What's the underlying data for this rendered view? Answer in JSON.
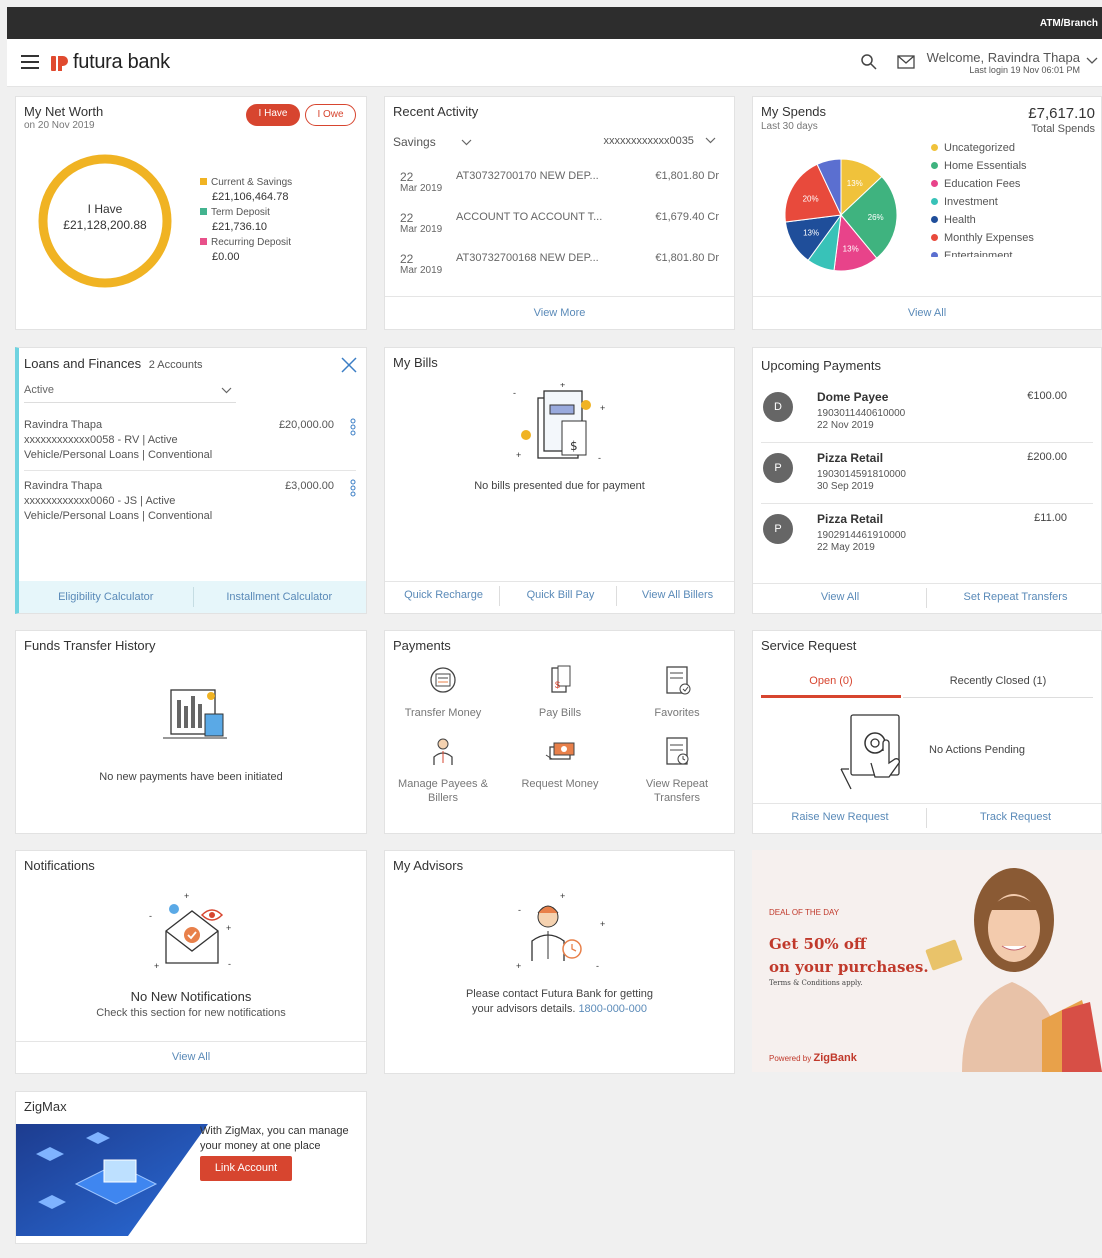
{
  "topbar": {
    "atm_label": "ATM/Branch"
  },
  "header": {
    "logo_text": "futura bank",
    "welcome": "Welcome, Ravindra Thapa",
    "last_login": "Last login 19 Nov 06:01 PM"
  },
  "net_worth": {
    "title": "My Net Worth",
    "date": "on 20 Nov 2019",
    "tab_have": "I Have",
    "tab_owe": "I Owe",
    "center_label": "I Have",
    "center_value": "£21,128,200.88",
    "legend": [
      {
        "label": "Current & Savings",
        "value": "£21,106,464.78",
        "color": "#f0b323"
      },
      {
        "label": "Term Deposit",
        "value": "£21,736.10",
        "color": "#43b38f"
      },
      {
        "label": "Recurring Deposit",
        "value": "£0.00",
        "color": "#e8518a"
      }
    ]
  },
  "recent_activity": {
    "title": "Recent Activity",
    "account_type": "Savings",
    "account_number": "xxxxxxxxxxxx0035",
    "rows": [
      {
        "day": "22",
        "month_year": "Mar 2019",
        "desc": "AT30732700170 NEW DEP...",
        "amount": "€1,801.80 Dr"
      },
      {
        "day": "22",
        "month_year": "Mar 2019",
        "desc": "ACCOUNT TO ACCOUNT T...",
        "amount": "€1,679.40 Cr"
      },
      {
        "day": "22",
        "month_year": "Mar 2019",
        "desc": "AT30732700168 NEW DEP...",
        "amount": "€1,801.80 Dr"
      }
    ],
    "view_more": "View More"
  },
  "spends": {
    "title": "My Spends",
    "period": "Last 30 days",
    "total": "£7,617.10",
    "total_label": "Total Spends",
    "legend": [
      {
        "label": "Uncategorized",
        "color": "#f0c23b"
      },
      {
        "label": "Home Essentials",
        "color": "#3fb37f"
      },
      {
        "label": "Education Fees",
        "color": "#e8438a"
      },
      {
        "label": "Investment",
        "color": "#38c2b8"
      },
      {
        "label": "Health",
        "color": "#1f4e9a"
      },
      {
        "label": "Monthly Expenses",
        "color": "#e84a3c"
      },
      {
        "label": "Entertainment",
        "color": "#5b6fd0"
      }
    ],
    "view_all": "View All"
  },
  "chart_data": {
    "type": "pie",
    "slices": [
      {
        "label": "13%",
        "value": 13,
        "color": "#f0c23b"
      },
      {
        "label": "26%",
        "value": 26,
        "color": "#3fb37f"
      },
      {
        "label": "13%",
        "value": 13,
        "color": "#e8438a"
      },
      {
        "label": "",
        "value": 8,
        "color": "#38c2b8"
      },
      {
        "label": "13%",
        "value": 13,
        "color": "#1f4e9a"
      },
      {
        "label": "20%",
        "value": 20,
        "color": "#e84a3c"
      },
      {
        "label": "",
        "value": 7,
        "color": "#5b6fd0"
      }
    ]
  },
  "loans": {
    "title": "Loans and Finances",
    "count": "2 Accounts",
    "filter": "Active",
    "items": [
      {
        "name": "Ravindra Thapa",
        "amount": "£20,000.00",
        "account": "xxxxxxxxxxxx0058 - RV | Active",
        "type": "Vehicle/Personal Loans | Conventional"
      },
      {
        "name": "Ravindra Thapa",
        "amount": "£3,000.00",
        "account": "xxxxxxxxxxxx0060 - JS | Active",
        "type": "Vehicle/Personal Loans | Conventional"
      }
    ],
    "eligibility": "Eligibility Calculator",
    "installment": "Installment Calculator"
  },
  "bills": {
    "title": "My Bills",
    "empty": "No bills presented due for payment",
    "quick_recharge": "Quick Recharge",
    "quick_bill_pay": "Quick Bill Pay",
    "view_all_billers": "View All Billers"
  },
  "upcoming": {
    "title": "Upcoming Payments",
    "items": [
      {
        "initial": "D",
        "name": "Dome Payee",
        "ref": "1903011440610000",
        "date": "22 Nov 2019",
        "amount": "€100.00"
      },
      {
        "initial": "P",
        "name": "Pizza Retail",
        "ref": "1903014591810000",
        "date": "30 Sep 2019",
        "amount": "£200.00"
      },
      {
        "initial": "P",
        "name": "Pizza Retail",
        "ref": "1902914461910000",
        "date": "22 May 2019",
        "amount": "£11.00"
      }
    ],
    "view_all": "View All",
    "set_repeat": "Set Repeat Transfers"
  },
  "funds_history": {
    "title": "Funds Transfer History",
    "empty": "No new payments have been initiated"
  },
  "payments": {
    "title": "Payments",
    "tiles": [
      {
        "label": "Transfer Money",
        "icon": "transfer-money-icon"
      },
      {
        "label": "Pay Bills",
        "icon": "pay-bills-icon"
      },
      {
        "label": "Favorites",
        "icon": "favorites-icon"
      },
      {
        "label": "Manage Payees & Billers",
        "icon": "manage-payees-icon"
      },
      {
        "label": "Request Money",
        "icon": "request-money-icon"
      },
      {
        "label": "View Repeat Transfers",
        "icon": "repeat-transfers-icon"
      }
    ]
  },
  "service": {
    "title": "Service Request",
    "tab_open": "Open (0)",
    "tab_closed": "Recently Closed (1)",
    "empty": "No Actions Pending",
    "raise": "Raise New Request",
    "track": "Track Request"
  },
  "notifications": {
    "title": "Notifications",
    "empty_title": "No New Notifications",
    "empty_sub": "Check this section for new notifications",
    "view_all": "View All"
  },
  "advisors": {
    "title": "My Advisors",
    "msg_line1": "Please contact Futura Bank for getting",
    "msg_line2": "your advisors details.",
    "phone": "1800-000-000"
  },
  "promo": {
    "deal": "DEAL OF THE DAY",
    "headline1": "Get 50% off",
    "headline2": "on your purchases.",
    "terms": "Terms & Conditions apply.",
    "powered_prefix": "Powered by",
    "powered_brand": "ZigBank"
  },
  "zigmax": {
    "title": "ZigMax",
    "text": "With ZigMax, you can manage your money at one place",
    "button": "Link Account"
  }
}
